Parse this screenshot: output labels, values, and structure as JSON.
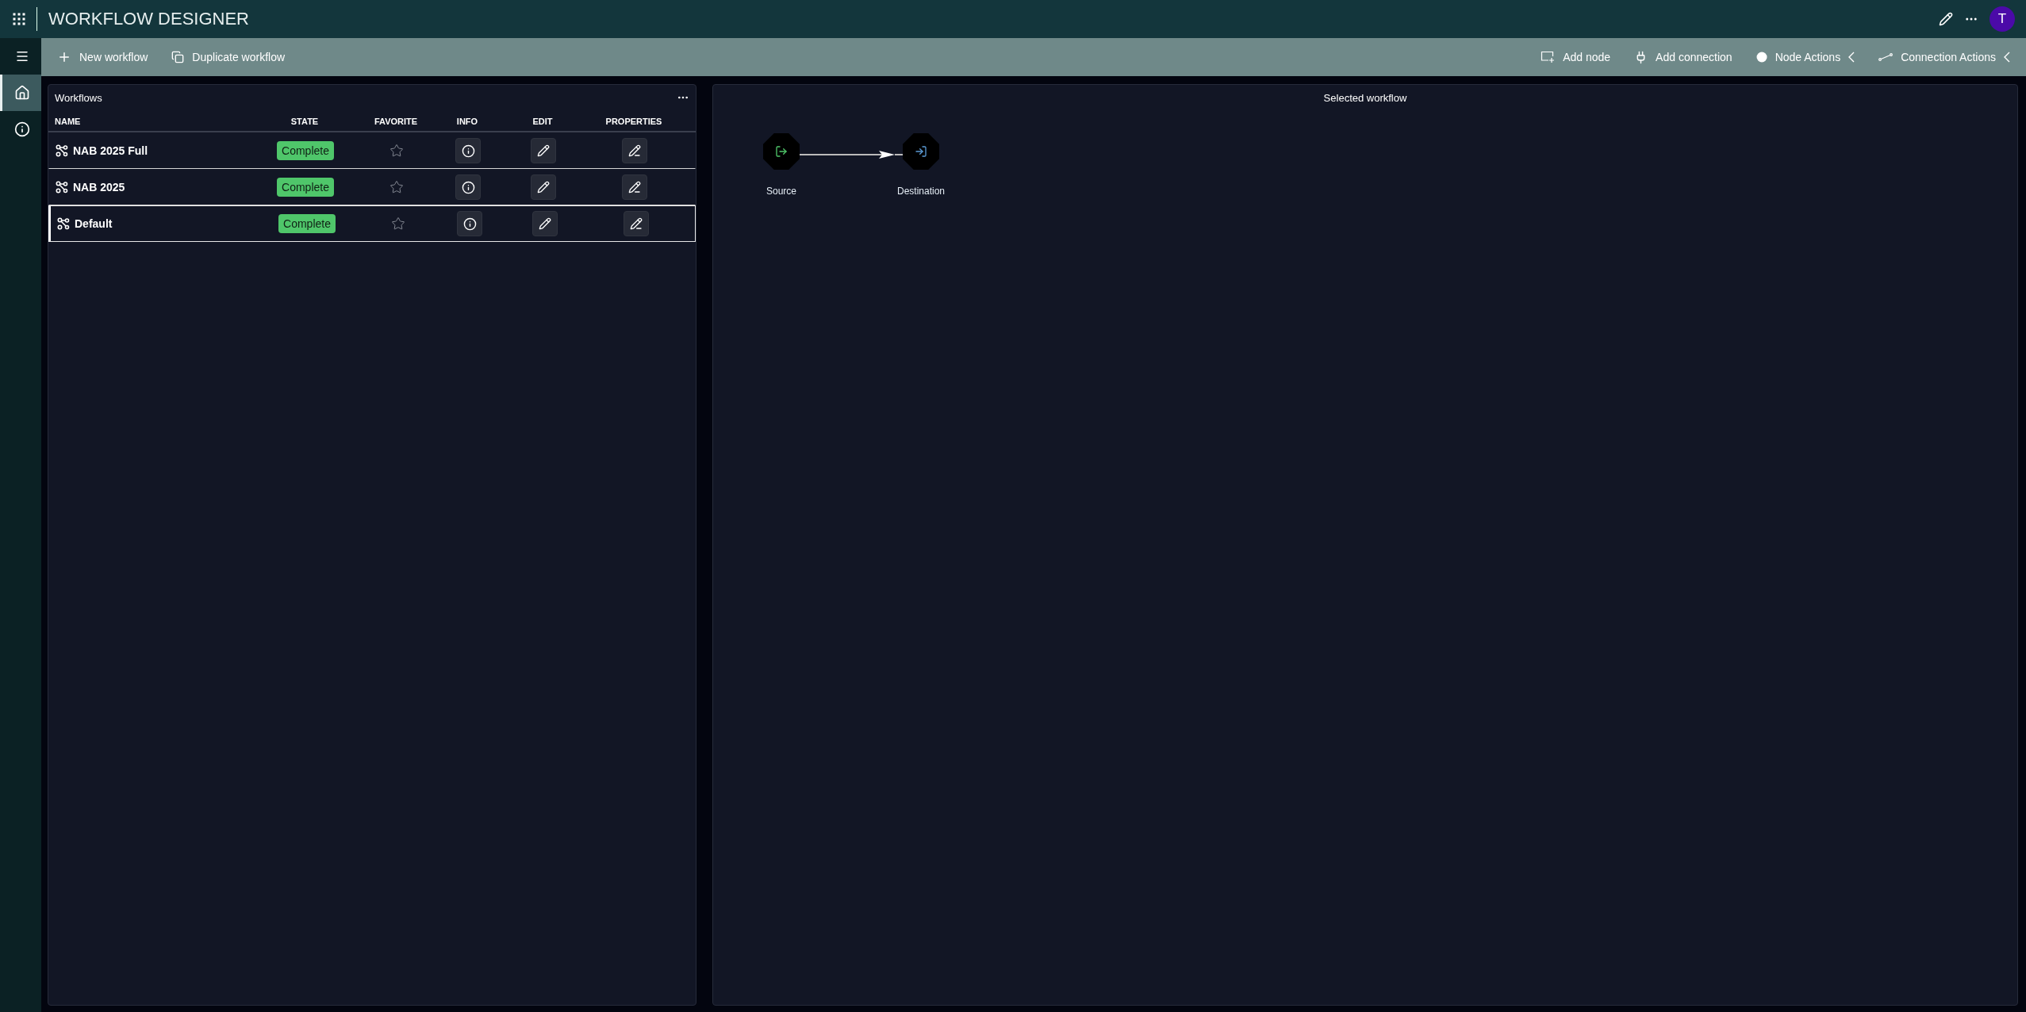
{
  "header": {
    "title": "WORKFLOW DESIGNER",
    "avatar": "T"
  },
  "toolbar": {
    "left": [
      {
        "kind": "new",
        "label": "New workflow"
      },
      {
        "kind": "duplicate",
        "label": "Duplicate workflow"
      }
    ],
    "right": [
      {
        "kind": "add-node",
        "label": "Add node",
        "menu": false
      },
      {
        "kind": "add-connection",
        "label": "Add connection",
        "menu": false
      },
      {
        "kind": "node-actions",
        "label": "Node Actions",
        "menu": true
      },
      {
        "kind": "connection-actions",
        "label": "Connection Actions",
        "menu": true
      }
    ]
  },
  "sidebar": {
    "items": [
      {
        "kind": "home",
        "selected": true
      },
      {
        "kind": "info",
        "selected": false
      }
    ]
  },
  "workflows": {
    "title": "Workflows",
    "columns": [
      "NAME",
      "STATE",
      "FAVORITE",
      "INFO",
      "EDIT",
      "PROPERTIES"
    ],
    "rows": [
      {
        "name": "NAB 2025 Full",
        "state": "Complete",
        "favorite": false,
        "selected": false
      },
      {
        "name": "NAB 2025",
        "state": "Complete",
        "favorite": false,
        "selected": false
      },
      {
        "name": "Default",
        "state": "Complete",
        "favorite": false,
        "selected": true
      }
    ]
  },
  "canvas": {
    "title": "Selected workflow",
    "nodes": [
      {
        "kind": "source",
        "label": "Source"
      },
      {
        "kind": "destination",
        "label": "Destination"
      }
    ]
  }
}
